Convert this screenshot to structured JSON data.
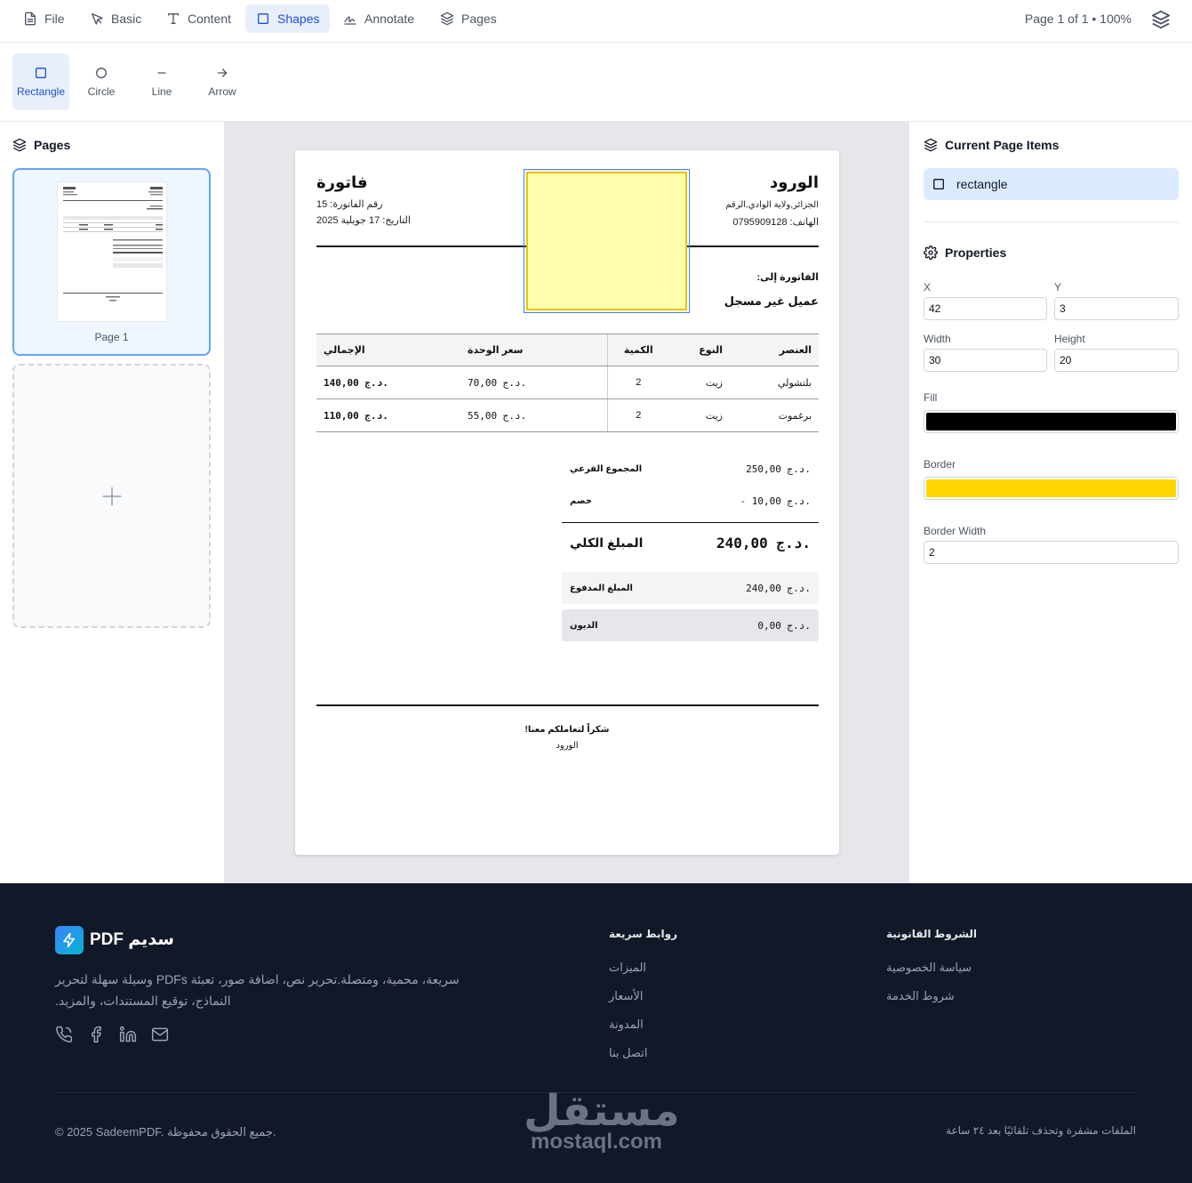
{
  "toolbar": {
    "tabs": [
      {
        "label": "File",
        "icon": "file-icon"
      },
      {
        "label": "Basic",
        "icon": "pointer-icon"
      },
      {
        "label": "Content",
        "icon": "text-icon"
      },
      {
        "label": "Shapes",
        "icon": "square-icon",
        "active": true
      },
      {
        "label": "Annotate",
        "icon": "signature-icon"
      },
      {
        "label": "Pages",
        "icon": "layers-icon"
      }
    ],
    "page_info": "Page 1 of 1 • 100%"
  },
  "shapes_tools": [
    {
      "label": "Rectangle",
      "icon": "square-icon",
      "active": true
    },
    {
      "label": "Circle",
      "icon": "circle-icon"
    },
    {
      "label": "Line",
      "icon": "minus-icon"
    },
    {
      "label": "Arrow",
      "icon": "arrow-right-icon"
    }
  ],
  "pages_panel": {
    "title": "Pages",
    "pages": [
      {
        "label": "Page 1"
      }
    ],
    "add_icon": "plus-icon"
  },
  "invoice": {
    "title": "فاتورة",
    "number_line": "رقم الفاتورة: 15",
    "date_line": "التاريخ: 17 جويلية 2025",
    "brand": "الورود",
    "address": "الجزائر,ولاية الوادي,الرقم",
    "phone": "الهاتف: 0795909128",
    "bill_to_label": "الفاتورة إلى:",
    "customer": "عميل غير مسجل",
    "columns": [
      "العنصر",
      "النوع",
      "الكمية",
      "سعر الوحدة",
      "الإجمالي"
    ],
    "rows": [
      {
        "item": "بلتشولي",
        "type": "زيت",
        "qty": "2",
        "unit": "70,00 د.ج.",
        "total": "140,00 د.ج."
      },
      {
        "item": "برغموت",
        "type": "زيت",
        "qty": "2",
        "unit": "55,00 د.ج.",
        "total": "110,00 د.ج."
      }
    ],
    "subtotal_label": "المجموع الفرعي",
    "subtotal_value": "250,00 د.ج.",
    "discount_label": "خصم",
    "discount_value": "- 10,00 د.ج.",
    "grand_label": "المبلغ الكلي",
    "grand_value": "240,00 د.ج.",
    "paid_label": "المبلغ المدفوع",
    "paid_value": "240,00 د.ج.",
    "debt_label": "الديون",
    "debt_value": "0,00 د.ج.",
    "thanks": "شكراً لتعاملكم معنا!",
    "signoff": "الورود"
  },
  "right_panel": {
    "items_title": "Current Page Items",
    "items": [
      {
        "label": "rectangle",
        "icon": "square-icon"
      }
    ],
    "properties_title": "Properties",
    "x_label": "X",
    "x_value": "42",
    "y_label": "Y",
    "y_value": "3",
    "width_label": "Width",
    "width_value": "30",
    "height_label": "Height",
    "height_value": "20",
    "fill_label": "Fill",
    "fill_color": "#000000",
    "border_label": "Border",
    "border_color": "#ffd700",
    "border_width_label": "Border Width",
    "border_width_value": "2"
  },
  "footer": {
    "brand": "سديم PDF",
    "description": "سريعة، محمية، ومتصلة.تحرير نص، اضافة صور، تعبئة PDFs وسيلة سهلة لتحرير النماذج، توقيع المستندات، والمزيد.",
    "quick_links_title": "روابط سريعة",
    "quick_links": [
      "الميزات",
      "الأسعار",
      "المدونة",
      "اتصل بنا"
    ],
    "legal_title": "الشروط القانونية",
    "legal_links": [
      "سياسة الخصوصية",
      "شروط الخدمة"
    ],
    "copyright": "© 2025 SadeemPDF. جميع الحقوق محفوظة.",
    "note": "الملفات مشفرة وتحذف تلقائيًا بعد ٢٤ ساعة",
    "social_icons": [
      "phone-icon",
      "facebook-icon",
      "linkedin-icon",
      "mail-icon"
    ],
    "watermark_ar": "مستقل",
    "watermark_en": "mostaql.com"
  },
  "colors": {
    "accent": "#1d4ed8",
    "accent_bg": "#e8effb",
    "footer_bg": "#111827",
    "selected_shape_fill": "#fefdab",
    "selected_shape_border": "#e9c400"
  }
}
